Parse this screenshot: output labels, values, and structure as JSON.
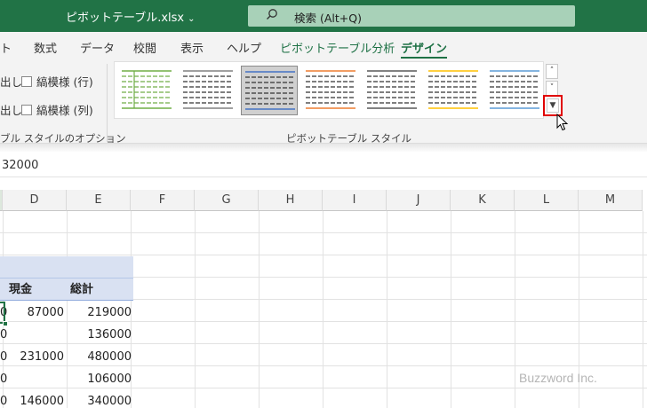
{
  "title_bar": {
    "filename": "ピボットテーブル.xlsx",
    "search_placeholder": "検索 (Alt+Q)"
  },
  "tabs": [
    {
      "label": "ト"
    },
    {
      "label": "数式"
    },
    {
      "label": "データ"
    },
    {
      "label": "校閲"
    },
    {
      "label": "表示"
    },
    {
      "label": "ヘルプ"
    },
    {
      "label": "ピボットテーブル分析"
    },
    {
      "label": "デザイン",
      "active": true
    }
  ],
  "ribbon": {
    "options": {
      "row_header_stub": "出し",
      "col_header_stub": "出し",
      "banded_rows": "縞模様 (行)",
      "banded_cols": "縞模様 (列)",
      "group_label": "ブル スタイルのオプション"
    },
    "styles": {
      "group_label": "ピボットテーブル スタイル",
      "swatch_colors": [
        "#70ad47",
        "#808080",
        "#4472c4",
        "#ed7d31",
        "#595959",
        "#ffc000",
        "#5b9bd5"
      ],
      "selected_index": 2
    }
  },
  "formula_bar": {
    "value": "32000"
  },
  "columns": [
    "D",
    "E",
    "F",
    "G",
    "H",
    "I",
    "J",
    "K",
    "L",
    "M"
  ],
  "pivot": {
    "headers": [
      "現金",
      "総計"
    ],
    "rows": [
      {
        "stub": "0",
        "d": "87000",
        "e": "219000"
      },
      {
        "stub": "0",
        "d": "",
        "e": "136000"
      },
      {
        "stub": "0",
        "d": "231000",
        "e": "480000"
      },
      {
        "stub": "0",
        "d": "",
        "e": "106000"
      },
      {
        "stub": "0",
        "d": "146000",
        "e": "340000"
      }
    ]
  },
  "watermark": "Buzzword Inc."
}
